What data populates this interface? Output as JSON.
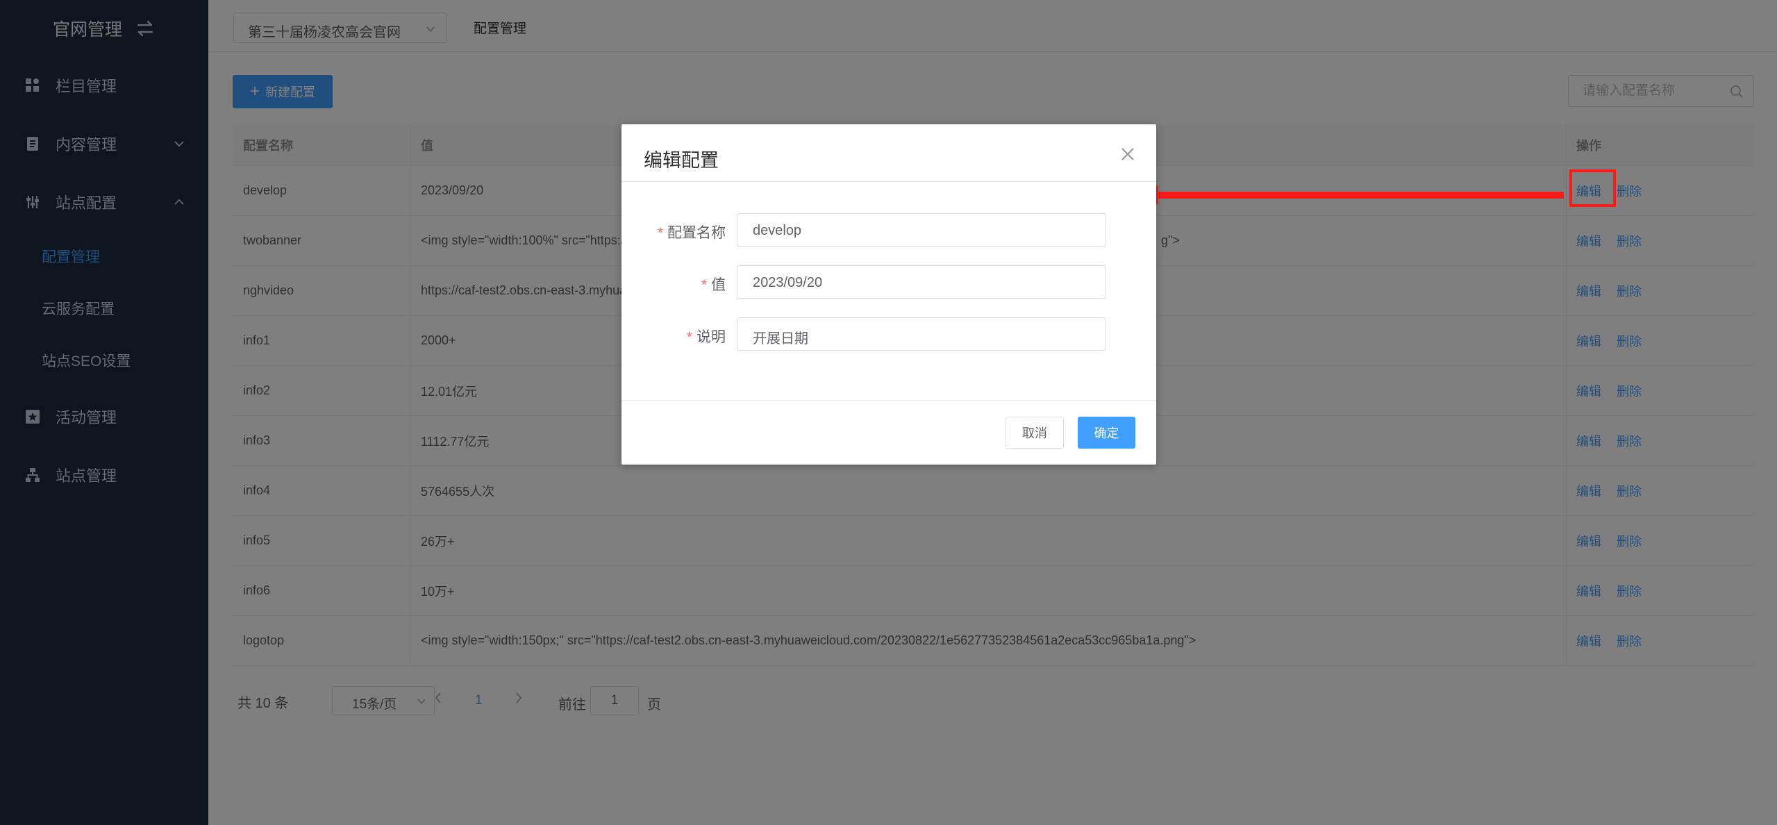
{
  "sidebar": {
    "title": "官网管理",
    "menu": [
      {
        "label": "栏目管理",
        "icon": "grid-icon"
      },
      {
        "label": "内容管理",
        "icon": "document-icon"
      },
      {
        "label": "站点配置",
        "icon": "settings-sliders-icon"
      },
      {
        "label": "活动管理",
        "icon": "star-box-icon"
      },
      {
        "label": "站点管理",
        "icon": "sitemap-icon"
      }
    ],
    "submenu": [
      {
        "label": "配置管理",
        "active": true
      },
      {
        "label": "云服务配置"
      },
      {
        "label": "站点SEO设置"
      }
    ]
  },
  "topbar": {
    "site_select": "第三十届杨凌农高会官网",
    "breadcrumb": "配置管理"
  },
  "toolbar": {
    "new_button": "新建配置",
    "search_placeholder": "请输入配置名称"
  },
  "table": {
    "headers": [
      "配置名称",
      "值",
      "操作"
    ],
    "rows": [
      {
        "name": "develop",
        "value": "2023/09/20"
      },
      {
        "name": "twobanner",
        "value": "<img style=\"width:100%\" src=\"https:/",
        "value_tail": "g\">"
      },
      {
        "name": "nghvideo",
        "value": "https://caf-test2.obs.cn-east-3.myhua"
      },
      {
        "name": "info1",
        "value": "2000+"
      },
      {
        "name": "info2",
        "value": "12.01亿元"
      },
      {
        "name": "info3",
        "value": "1112.77亿元"
      },
      {
        "name": "info4",
        "value": "5764655人次"
      },
      {
        "name": "info5",
        "value": "26万+"
      },
      {
        "name": "info6",
        "value": "10万+"
      },
      {
        "name": "logotop",
        "value": "<img style=\"width:150px;\" src=\"https://caf-test2.obs.cn-east-3.myhuaweicloud.com/20230822/1e56277352384561a2eca53cc965ba1a.png\">"
      }
    ],
    "edit_label": "编辑",
    "delete_label": "删除"
  },
  "pagination": {
    "total": "共 10 条",
    "page_size": "15条/页",
    "current_page": "1",
    "goto_prefix": "前往",
    "goto_value": "1",
    "goto_suffix": "页"
  },
  "dialog": {
    "title": "编辑配置",
    "fields": [
      {
        "label": "配置名称",
        "value": "develop"
      },
      {
        "label": "值",
        "value": "2023/09/20"
      },
      {
        "label": "说明",
        "value": "开展日期"
      }
    ],
    "cancel": "取消",
    "confirm": "确定"
  },
  "colors": {
    "sidebar_bg": "#1c2a3d",
    "accent": "#409eff",
    "annotation": "#ff1a1a"
  }
}
